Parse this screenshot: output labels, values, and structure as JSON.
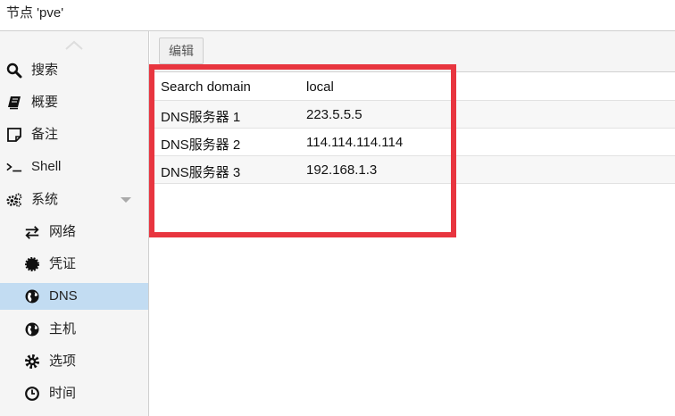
{
  "header": {
    "title": "节点 'pve'"
  },
  "sidebar": {
    "items": [
      {
        "label": "搜索",
        "icon": "search-icon"
      },
      {
        "label": "概要",
        "icon": "book-icon"
      },
      {
        "label": "备注",
        "icon": "note-icon"
      },
      {
        "label": "Shell",
        "icon": "terminal-icon"
      },
      {
        "label": "系统",
        "icon": "cogs-icon"
      },
      {
        "label": "网络",
        "icon": "exchange-icon"
      },
      {
        "label": "凭证",
        "icon": "certificate-icon"
      },
      {
        "label": "DNS",
        "icon": "globe-icon"
      },
      {
        "label": "主机",
        "icon": "globe-icon"
      },
      {
        "label": "选项",
        "icon": "gear-icon"
      },
      {
        "label": "时间",
        "icon": "clock-icon"
      }
    ],
    "selected": "DNS"
  },
  "toolbar": {
    "edit_label": "编辑"
  },
  "dns": {
    "rows": [
      {
        "key": "Search domain",
        "value": "local"
      },
      {
        "key": "DNS服务器 1",
        "value": "223.5.5.5"
      },
      {
        "key": "DNS服务器 2",
        "value": "114.114.114.114"
      },
      {
        "key": "DNS服务器 3",
        "value": "192.168.1.3"
      }
    ]
  },
  "colors": {
    "selected_bg": "#c2dcf2",
    "highlight_border": "#e8353f"
  }
}
